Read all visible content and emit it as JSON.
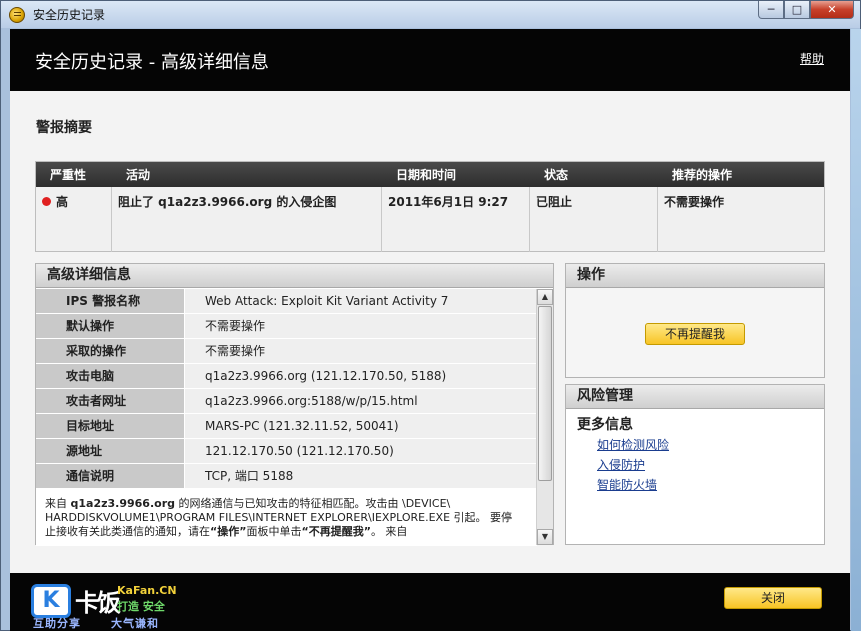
{
  "window": {
    "title": "安全历史记录",
    "controls": {
      "minimize": "─",
      "maximize": "□",
      "close": "✕"
    }
  },
  "header": {
    "title": "安全历史记录 - 高级详细信息",
    "help": "帮助"
  },
  "alert_summary": {
    "title": "警报摘要",
    "columns": [
      "严重性",
      "活动",
      "日期和时间",
      "状态",
      "推荐的操作"
    ],
    "row": {
      "severity": "高",
      "severity_color": "#e02020",
      "activity": "阻止了 q1a2z3.9966.org 的入侵企图",
      "datetime": "2011年6月1日 9:27",
      "status": "已阻止",
      "recommended": "不需要操作"
    }
  },
  "details": {
    "title": "高级详细信息",
    "rows": [
      {
        "label": "IPS 警报名称",
        "value": "Web Attack: Exploit Kit Variant Activity 7"
      },
      {
        "label": "默认操作",
        "value": "不需要操作"
      },
      {
        "label": "采取的操作",
        "value": "不需要操作"
      },
      {
        "label": "攻击电脑",
        "value": "q1a2z3.9966.org (121.12.170.50, 5188)"
      },
      {
        "label": "攻击者网址",
        "value": "q1a2z3.9966.org:5188/w/p/15.html"
      },
      {
        "label": "目标地址",
        "value": "MARS-PC (121.32.11.52, 50041)"
      },
      {
        "label": "源地址",
        "value": "121.12.170.50 (121.12.170.50)"
      },
      {
        "label": "通信说明",
        "value": "TCP, 端口 5188"
      }
    ],
    "description": {
      "prefix": "来自 ",
      "host": "q1a2z3.9966.org",
      "line1_rest": " 的网络通信与已知攻击的特征相匹配。攻击由 \\DEVICE\\",
      "line2": "HARDDISKVOLUME1\\PROGRAM FILES\\INTERNET EXPLORER\\IEXPLORE.EXE 引起。 要停",
      "line3_a": "止接收有关此类通信的通知，请在",
      "line3_b": "“操作”",
      "line3_c": "面板中单击",
      "line3_d": "“不再提醒我”",
      "line3_e": "。 来自"
    }
  },
  "operations": {
    "title": "操作",
    "dismiss_button": "不再提醒我"
  },
  "risk": {
    "title": "风险管理",
    "more_info": "更多信息",
    "links": [
      "如何检测风险",
      "入侵防护",
      "智能防火墙"
    ]
  },
  "footer": {
    "close_button": "关闭"
  },
  "watermark": {
    "logo": "K",
    "big_text": "卡饭",
    "site": "KaFan.CN",
    "subtitle": "打造 安全",
    "line1": "互助分享",
    "line2": "大气谦和"
  }
}
